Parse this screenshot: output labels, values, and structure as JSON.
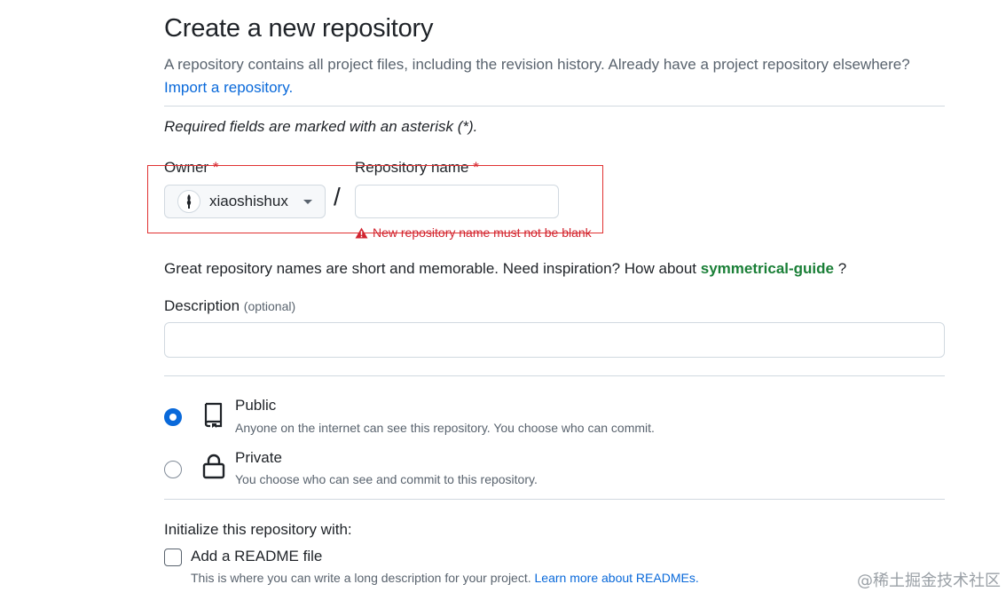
{
  "header": {
    "title": "Create a new repository",
    "subtitle": "A repository contains all project files, including the revision history. Already have a project repository elsewhere?",
    "import_link": "Import a repository."
  },
  "form": {
    "required_note": "Required fields are marked with an asterisk (*).",
    "owner_label": "Owner",
    "asterisk": "*",
    "owner_value": "xiaoshishux",
    "separator": "/",
    "repo_label": "Repository name",
    "repo_value": "",
    "error_message": "New repository name must not be blank",
    "inspiration_text": "Great repository names are short and memorable. Need inspiration? How about",
    "suggested_name": "symmetrical-guide",
    "inspiration_end": "?",
    "description_label": "Description",
    "description_optional": "(optional)",
    "description_value": ""
  },
  "visibility": {
    "selected": "public",
    "public_title": "Public",
    "public_desc": "Anyone on the internet can see this repository. You choose who can commit.",
    "private_title": "Private",
    "private_desc": "You choose who can see and commit to this repository."
  },
  "initialize": {
    "heading": "Initialize this repository with:",
    "readme_label": "Add a README file",
    "readme_checked": false,
    "readme_desc": "This is where you can write a long description for your project.",
    "readme_link": "Learn more about READMEs."
  },
  "watermark": "@稀土掘金技术社区",
  "colors": {
    "accent": "#0969da",
    "danger": "#d1242f",
    "success": "#1a7f37",
    "annotation_box": "#e03131"
  },
  "icons": {
    "owner_avatar": "avatar",
    "owner_dropdown": "caret-down-icon",
    "error": "alert-icon",
    "public": "repo-icon",
    "private": "lock-icon"
  }
}
